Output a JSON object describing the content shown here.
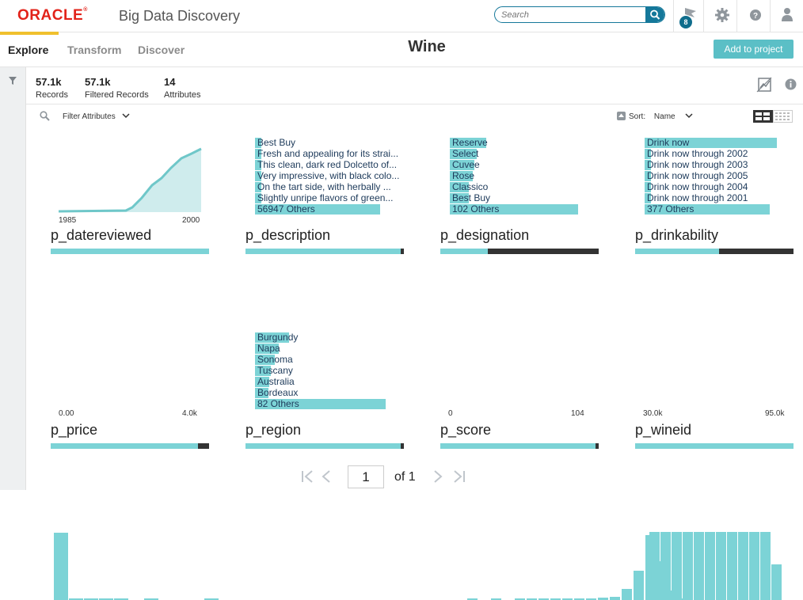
{
  "brand": {
    "logo": "ORACLE",
    "app_name": "Big Data Discovery"
  },
  "search": {
    "placeholder": "Search"
  },
  "header": {
    "notification_count": "8"
  },
  "tabs": [
    {
      "label": "Explore",
      "active": true
    },
    {
      "label": "Transform",
      "active": false
    },
    {
      "label": "Discover",
      "active": false
    }
  ],
  "page_title": "Wine",
  "add_button": "Add to project",
  "stats": {
    "records": {
      "value": "57.1k",
      "label": "Records"
    },
    "filtered": {
      "value": "57.1k",
      "label": "Filtered Records"
    },
    "attributes": {
      "value": "14",
      "label": "Attributes"
    }
  },
  "filter_label": "Filter Attributes",
  "sort": {
    "label": "Sort:",
    "value": "Name"
  },
  "colors": {
    "accent": "#5bbfc6",
    "bar": "#7cd3d6",
    "dark": "#333333",
    "brand_red": "#e2231a"
  },
  "cards": {
    "datereviewed": {
      "name": "p_datereviewed",
      "axis_min": "1985",
      "axis_max": "2000",
      "completeness": 1.0
    },
    "description": {
      "name": "p_description",
      "items": [
        {
          "label": "Best Buy",
          "share": 0.01
        },
        {
          "label": "Fresh and appealing for its strai...",
          "share": 0.01
        },
        {
          "label": "This clean, dark red Dolcetto of...",
          "share": 0.01
        },
        {
          "label": "Very impressive, with black colo...",
          "share": 0.01
        },
        {
          "label": "On the tart side, with herbally ...",
          "share": 0.01
        },
        {
          "label": "Slightly unripe flavors of green...",
          "share": 0.01
        },
        {
          "label": "56947 Others",
          "share": 0.88
        }
      ],
      "completeness": 0.98
    },
    "designation": {
      "name": "p_designation",
      "items": [
        {
          "label": "Reserve",
          "share": 0.27
        },
        {
          "label": "Select",
          "share": 0.2
        },
        {
          "label": "Cuvee",
          "share": 0.18
        },
        {
          "label": "Rose",
          "share": 0.17
        },
        {
          "label": "Classico",
          "share": 0.14
        },
        {
          "label": "Best Buy",
          "share": 0.14
        },
        {
          "label": "102 Others",
          "share": 0.95
        }
      ],
      "completeness": 0.3
    },
    "drinkability": {
      "name": "p_drinkability",
      "items": [
        {
          "label": "Drink now",
          "share": 0.95
        },
        {
          "label": "Drink now through 2002",
          "share": 0.03
        },
        {
          "label": "Drink now through 2003",
          "share": 0.03
        },
        {
          "label": "Drink now through 2005",
          "share": 0.03
        },
        {
          "label": "Drink now through 2004",
          "share": 0.03
        },
        {
          "label": "Drink now through 2001",
          "share": 0.03
        },
        {
          "label": "377 Others",
          "share": 0.9
        }
      ],
      "completeness": 0.53
    },
    "price": {
      "name": "p_price",
      "axis_min": "0.00",
      "axis_max": "4.0k",
      "bins": [
        1.0,
        0.01,
        0.01,
        0.01,
        0.01,
        0,
        0.01,
        0,
        0,
        0,
        0.01
      ],
      "completeness": 0.93
    },
    "region": {
      "name": "p_region",
      "items": [
        {
          "label": "Burgundy",
          "share": 0.26
        },
        {
          "label": "Napa",
          "share": 0.18
        },
        {
          "label": "Sonoma",
          "share": 0.15
        },
        {
          "label": "Tuscany",
          "share": 0.12
        },
        {
          "label": "Australia",
          "share": 0.11
        },
        {
          "label": "Bordeaux",
          "share": 0.1
        },
        {
          "label": "82 Others",
          "share": 1.0
        }
      ],
      "completeness": 0.98
    },
    "score": {
      "name": "p_score",
      "axis_min": "0",
      "axis_max": "104",
      "bins": [
        0,
        0,
        0.01,
        0,
        0.01,
        0,
        0.01,
        0.01,
        0.01,
        0.01,
        0.01,
        0.02,
        0.03,
        0.04,
        0.05,
        0.17,
        0.45,
        1.0,
        0.6,
        0.15,
        0.01
      ],
      "completeness": 0.98
    },
    "wineid": {
      "name": "p_wineid",
      "axis_min": "30.0k",
      "axis_max": "95.0k",
      "bins": [
        0.0,
        1.0,
        1.0,
        1.0,
        1.0,
        1.0,
        1.0,
        1.0,
        1.0,
        1.0,
        1.0,
        1.0,
        0.52
      ],
      "completeness": 1.0
    }
  },
  "pagination": {
    "page": "1",
    "of": "of 1"
  }
}
